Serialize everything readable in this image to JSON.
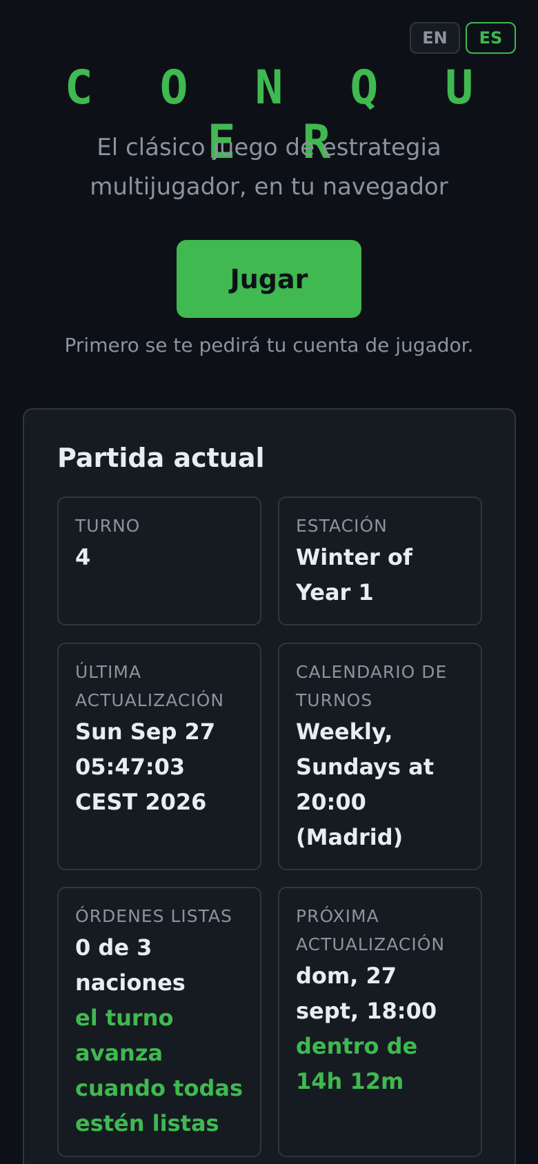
{
  "language_switch": {
    "en_label": "EN",
    "es_label": "ES",
    "active": "ES"
  },
  "hero": {
    "title": "C O N Q U E R",
    "tagline": "El clásico juego de estrategia multijugador, en tu navegador",
    "play_label": "Jugar",
    "hint": "Primero se te pedirá tu cuenta de jugador."
  },
  "current_game": {
    "title": "Partida actual",
    "turn": {
      "label": "TURNO",
      "value": "4"
    },
    "season": {
      "label": "ESTACIÓN",
      "value": "Winter of Year 1"
    },
    "last_update": {
      "label": "ÚLTIMA ACTUALIZACIÓN",
      "value": "Sun Sep 27 05:47:03 CEST 2026"
    },
    "schedule": {
      "label": "CALENDARIO DE TURNOS",
      "value": "Weekly, Sundays at 20:00 (Madrid)"
    },
    "orders_ready": {
      "label": "ÓRDENES LISTAS",
      "value": "0 de 3 naciones",
      "note": "el turno avanza cuando todas estén listas"
    },
    "next_update": {
      "label": "PRÓXIMA ACTUALIZACIÓN",
      "value": "dom, 27 sept, 18:00",
      "note": "dentro de 14h 12m"
    }
  },
  "colors": {
    "background": "#0d1117",
    "card": "#161b22",
    "border": "#30363d",
    "accent": "#3fb950",
    "muted": "#8b949e",
    "text": "#e6edf3"
  }
}
